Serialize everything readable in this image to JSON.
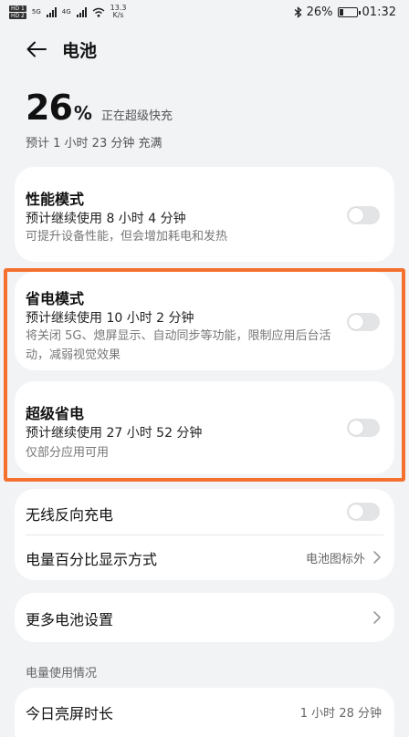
{
  "status_bar": {
    "hd1": "HD 1",
    "hd2": "HD 2",
    "net1": "5G",
    "net2": "4G",
    "speed_value": "13.3",
    "speed_unit": "K/s",
    "bluetooth_icon": "bluetooth-icon",
    "battery_text": "26%",
    "battery_level_percent": 26,
    "time": "01:32"
  },
  "header": {
    "back_icon": "arrow-left-icon",
    "title": "电池"
  },
  "battery": {
    "level": "26",
    "percent_sign": "%",
    "status": "正在超级快充",
    "estimate": "预计 1 小时 23 分钟 充满"
  },
  "performance_mode": {
    "title": "性能模式",
    "subtitle": "预计继续使用 8 小时 4 分钟",
    "description": "可提升设备性能，但会增加耗电和发热",
    "enabled": false
  },
  "power_saving_mode": {
    "title": "省电模式",
    "subtitle": "预计继续使用 10 小时 2 分钟",
    "description": "将关闭 5G、熄屏显示、自动同步等功能，限制应用后台活动，减弱视觉效果",
    "enabled": false
  },
  "super_power_saving": {
    "title": "超级省电",
    "subtitle": "预计继续使用 27 小时 52 分钟",
    "description": "仅部分应用可用",
    "enabled": false
  },
  "settings": {
    "wireless_reverse_charging": {
      "label": "无线反向充电",
      "enabled": false
    },
    "percentage_display": {
      "label": "电量百分比显示方式",
      "value": "电池图标外"
    }
  },
  "more_settings": {
    "label": "更多电池设置"
  },
  "usage": {
    "section_title": "电量使用情况",
    "screen_on_time_label": "今日亮屏时长",
    "screen_on_time_value": "1 小时 28 分钟"
  },
  "colors": {
    "background": "#f1f3f5",
    "card": "#ffffff",
    "highlight_border": "#f4702f",
    "toggle_off": "#e3e4e6"
  }
}
